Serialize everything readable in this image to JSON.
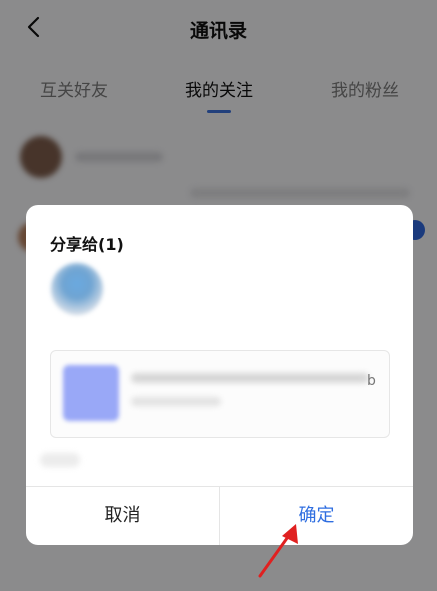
{
  "header": {
    "title": "通讯录"
  },
  "tabs": [
    {
      "label": "互关好友"
    },
    {
      "label": "我的关注"
    },
    {
      "label": "我的粉丝"
    }
  ],
  "dialog": {
    "title": "分享给(1)",
    "card_tail": "b",
    "cancel_label": "取消",
    "confirm_label": "确定"
  },
  "colors": {
    "accent": "#2f6ee0",
    "annotation_arrow": "#e02020"
  },
  "icons": {
    "back": "chevron-left-icon",
    "arrow": "red-pointer-arrow"
  }
}
